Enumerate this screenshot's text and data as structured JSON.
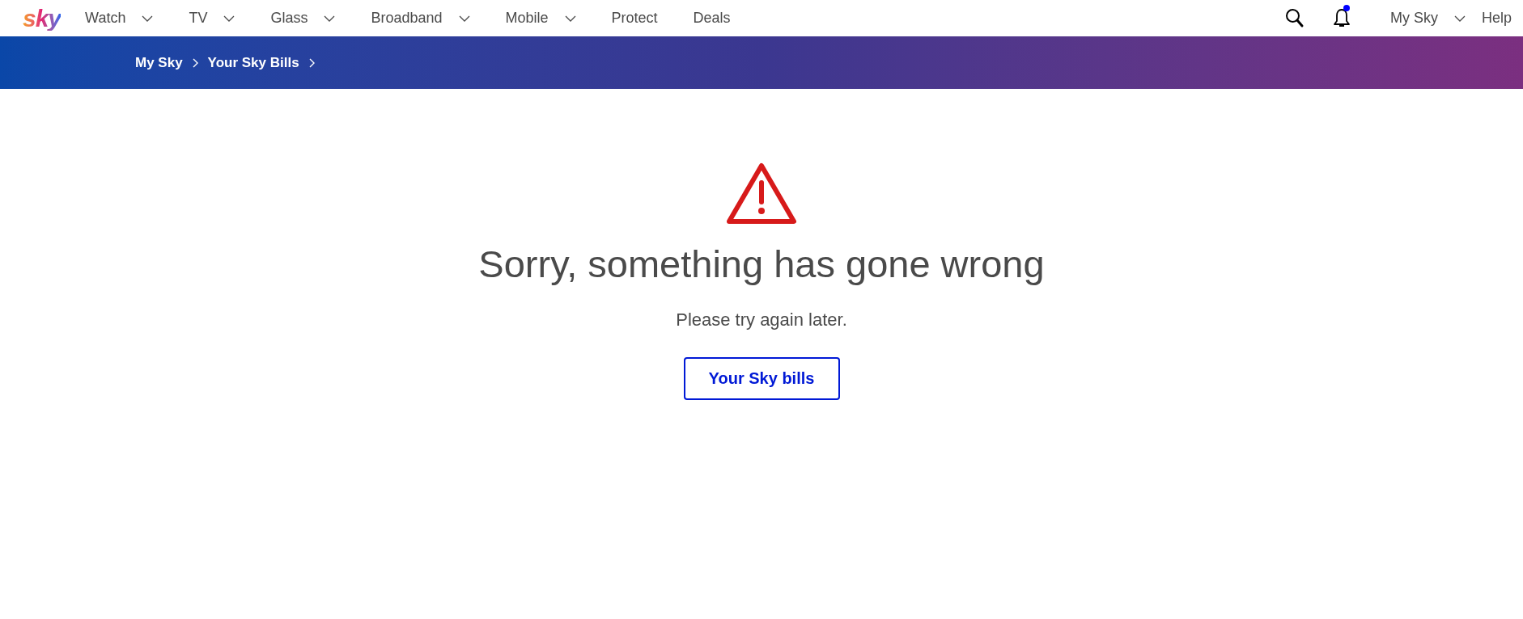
{
  "logo": "sky",
  "nav": [
    {
      "label": "Watch",
      "dropdown": true
    },
    {
      "label": "TV",
      "dropdown": true
    },
    {
      "label": "Glass",
      "dropdown": true
    },
    {
      "label": "Broadband",
      "dropdown": true
    },
    {
      "label": "Mobile",
      "dropdown": true
    },
    {
      "label": "Protect",
      "dropdown": false
    },
    {
      "label": "Deals",
      "dropdown": false
    }
  ],
  "notifications": {
    "unread": true
  },
  "account_menu": {
    "label": "My Sky",
    "dropdown": true
  },
  "help": "Help",
  "breadcrumb": [
    "My Sky",
    "Your Sky Bills"
  ],
  "error": {
    "title": "Sorry, something has gone wrong",
    "message": "Please try again later.",
    "button": "Your Sky bills"
  }
}
